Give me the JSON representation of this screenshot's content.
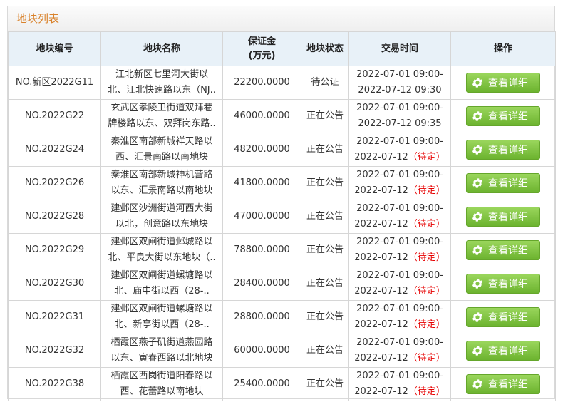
{
  "panel": {
    "title": "地块列表"
  },
  "columns": {
    "code": "地块编号",
    "name": "地块名称",
    "deposit_line1": "保证金",
    "deposit_line2": "(万元)",
    "status": "地块状态",
    "time": "交易时间",
    "action": "操作"
  },
  "action_label": "查看详细",
  "rows": [
    {
      "code": "NO.新区2022G11",
      "name1": "江北新区七里河大街以",
      "name2": "北、江北快速路以东（NJ..",
      "deposit": "22200.0000",
      "status": "待公证",
      "time1": "2022-07-01 09:00-",
      "time2": "2022-07-12 09:30",
      "time2_note": ""
    },
    {
      "code": "NO.2022G22",
      "name1": "玄武区孝陵卫街道双拜巷",
      "name2": "牌楼路以东、双拜岗东路..",
      "deposit": "46000.0000",
      "status": "正在公告",
      "time1": "2022-07-01 09:00-",
      "time2": "2022-07-12 09:35",
      "time2_note": ""
    },
    {
      "code": "NO.2022G24",
      "name1": "秦淮区南部新城祥天路以",
      "name2": "西、汇景南路以南地块",
      "deposit": "48200.0000",
      "status": "正在公告",
      "time1": "2022-07-01 09:00-",
      "time2": "2022-07-12",
      "time2_note": "（待定）"
    },
    {
      "code": "NO.2022G26",
      "name1": "秦淮区南部新城神机营路",
      "name2": "以东、汇景南路以南地块",
      "deposit": "41800.0000",
      "status": "正在公告",
      "time1": "2022-07-01 09:00-",
      "time2": "2022-07-12",
      "time2_note": "（待定）"
    },
    {
      "code": "NO.2022G28",
      "name1": "建邺区沙洲街道河西大街",
      "name2": "以北，创意路以东地块",
      "deposit": "47000.0000",
      "status": "正在公告",
      "time1": "2022-07-01 09:00-",
      "time2": "2022-07-12",
      "time2_note": "（待定）"
    },
    {
      "code": "NO.2022G29",
      "name1": "建邺区双闸街道邺城路以",
      "name2": "北、平良大街以东地块（..",
      "deposit": "78800.0000",
      "status": "正在公告",
      "time1": "2022-07-01 09:00-",
      "time2": "2022-07-12",
      "time2_note": "（待定）"
    },
    {
      "code": "NO.2022G30",
      "name1": "建邺区双闸街道螺塘路以",
      "name2": "北、庙中街以西（28-..",
      "deposit": "28400.0000",
      "status": "正在公告",
      "time1": "2022-07-01 09:00-",
      "time2": "2022-07-12",
      "time2_note": "（待定）"
    },
    {
      "code": "NO.2022G31",
      "name1": "建邺区双闸街道螺塘路以",
      "name2": "北、新亭街以西（28-..",
      "deposit": "28800.0000",
      "status": "正在公告",
      "time1": "2022-07-01 09:00-",
      "time2": "2022-07-12",
      "time2_note": "（待定）"
    },
    {
      "code": "NO.2022G32",
      "name1": "栖霞区燕子矶街道燕园路",
      "name2": "以东、寅春西路以北地块",
      "deposit": "60000.0000",
      "status": "正在公告",
      "time1": "2022-07-01 09:00-",
      "time2": "2022-07-12",
      "time2_note": "（待定）"
    },
    {
      "code": "NO.2022G38",
      "name1": "栖霞区西岗街道阳春路以",
      "name2": "西、花蕾路以南地块",
      "deposit": "25400.0000",
      "status": "正在公告",
      "time1": "2022-07-01 09:00-",
      "time2": "2022-07-12",
      "time2_note": "（待定）"
    }
  ],
  "colors": {
    "title": "#d9822b",
    "header_bg": "#e8f1f8",
    "button": "#7dc242",
    "pending": "#e60000"
  },
  "icons": {
    "button": "gear-icon"
  }
}
